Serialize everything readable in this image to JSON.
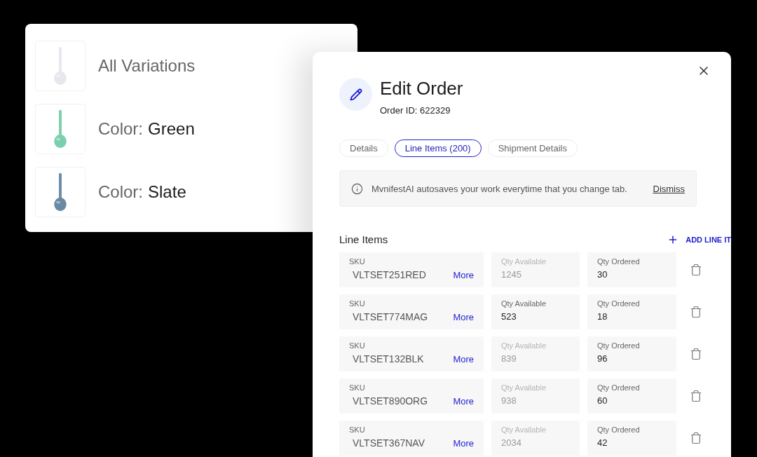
{
  "variations": [
    {
      "label": "All Variations",
      "kind": "picture"
    },
    {
      "label": "Color:",
      "value": "Green",
      "kind": "picture"
    },
    {
      "label": "Color:",
      "value": "Slate",
      "kind": "picture"
    }
  ],
  "dialog": {
    "title": "Edit Order",
    "subtitle": "Order ID: 622329",
    "tabs": [
      {
        "label": "Details",
        "selected": false
      },
      {
        "label": "Line Items (200)",
        "selected": true
      },
      {
        "label": "Shipment Details",
        "selected": false
      }
    ],
    "notice": {
      "text": "MvnifestAI autosaves your work everytime that you change tab.",
      "action": "Dismiss"
    },
    "section_title": "Line Items",
    "add_button": "ADD LINE IT",
    "rows": [
      {
        "sku_label": "SKU",
        "sku": "VLTSET251RED",
        "more": "More",
        "available_label": "Qty Available",
        "available": "1245",
        "available_disabled": true,
        "ordered_label": "Qty Ordered",
        "ordered": "30"
      },
      {
        "sku_label": "SKU",
        "sku": "VLTSET774MAG",
        "more": "More",
        "available_label": "Qty Available",
        "available": "523",
        "available_disabled": false,
        "ordered_label": "Qty Ordered",
        "ordered": "18"
      },
      {
        "sku_label": "SKU",
        "sku": "VLTSET132BLK",
        "more": "More",
        "available_label": "Qty Available",
        "available": "839",
        "available_disabled": true,
        "ordered_label": "Qty Ordered",
        "ordered": "96"
      },
      {
        "sku_label": "SKU",
        "sku": "VLTSET890ORG",
        "more": "More",
        "available_label": "Qty Available",
        "available": "938",
        "available_disabled": true,
        "ordered_label": "Qty Ordered",
        "ordered": "60"
      },
      {
        "sku_label": "SKU",
        "sku": "VLTSET367NAV",
        "more": "More",
        "available_label": "Qty Available",
        "available": "2034",
        "available_disabled": true,
        "ordered_label": "Qty Ordered",
        "ordered": "42"
      }
    ]
  }
}
